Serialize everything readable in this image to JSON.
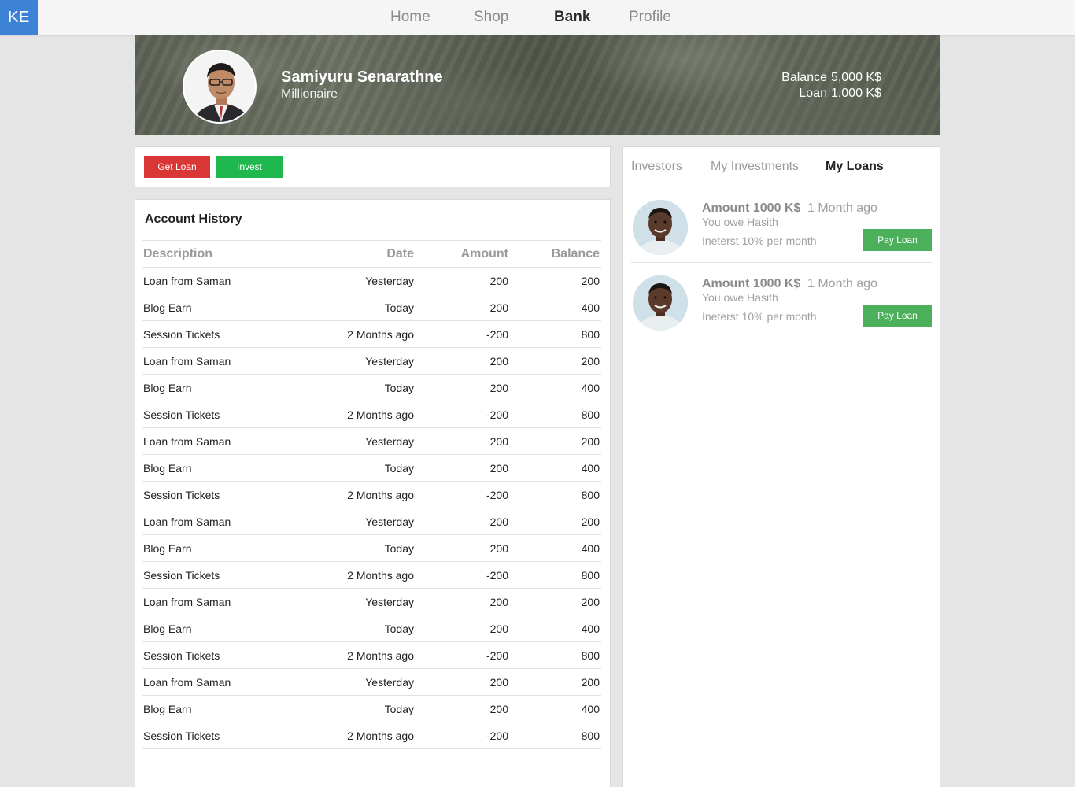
{
  "nav": {
    "logo": "KE",
    "links": [
      "Home",
      "Shop",
      "Bank",
      "Profile"
    ],
    "active": "Bank"
  },
  "profile": {
    "name": "Samiyuru Senarathne",
    "title": "Millionaire",
    "balance_label": "Balance",
    "balance_value": "5,000 K$",
    "loan_label": "Loan",
    "loan_value": "1,000 K$"
  },
  "actions": {
    "get_loan": "Get Loan",
    "invest": "Invest"
  },
  "colors": {
    "accent": "#3c83d6",
    "danger": "#d93636",
    "success": "#1fb84f",
    "pay": "#4caf5a"
  },
  "history": {
    "title": "Account History",
    "columns": [
      "Description",
      "Date",
      "Amount",
      "Balance"
    ],
    "rows": [
      [
        "Loan from Saman",
        "Yesterday",
        "200",
        "200"
      ],
      [
        "Blog Earn",
        "Today",
        "200",
        "400"
      ],
      [
        "Session Tickets",
        "2 Months ago",
        "-200",
        "800"
      ],
      [
        "Loan from Saman",
        "Yesterday",
        "200",
        "200"
      ],
      [
        "Blog Earn",
        "Today",
        "200",
        "400"
      ],
      [
        "Session Tickets",
        "2 Months ago",
        "-200",
        "800"
      ],
      [
        "Loan from Saman",
        "Yesterday",
        "200",
        "200"
      ],
      [
        "Blog Earn",
        "Today",
        "200",
        "400"
      ],
      [
        "Session Tickets",
        "2 Months ago",
        "-200",
        "800"
      ],
      [
        "Loan from Saman",
        "Yesterday",
        "200",
        "200"
      ],
      [
        "Blog Earn",
        "Today",
        "200",
        "400"
      ],
      [
        "Session Tickets",
        "2 Months ago",
        "-200",
        "800"
      ],
      [
        "Loan from Saman",
        "Yesterday",
        "200",
        "200"
      ],
      [
        "Blog Earn",
        "Today",
        "200",
        "400"
      ],
      [
        "Session Tickets",
        "2 Months ago",
        "-200",
        "800"
      ],
      [
        "Loan from Saman",
        "Yesterday",
        "200",
        "200"
      ],
      [
        "Blog Earn",
        "Today",
        "200",
        "400"
      ],
      [
        "Session Tickets",
        "2 Months ago",
        "-200",
        "800"
      ]
    ]
  },
  "side": {
    "tabs": [
      "Investors",
      "My Investments",
      "My Loans"
    ],
    "active_tab": "My Loans",
    "loans": [
      {
        "amount": "Amount 1000 K$",
        "time": "1 Month ago",
        "owe": "You owe Hasith",
        "interest": "Ineterst 10% per month",
        "button": "Pay Loan"
      },
      {
        "amount": "Amount 1000 K$",
        "time": "1 Month ago",
        "owe": "You owe Hasith",
        "interest": "Ineterst 10% per month",
        "button": "Pay Loan"
      }
    ]
  }
}
